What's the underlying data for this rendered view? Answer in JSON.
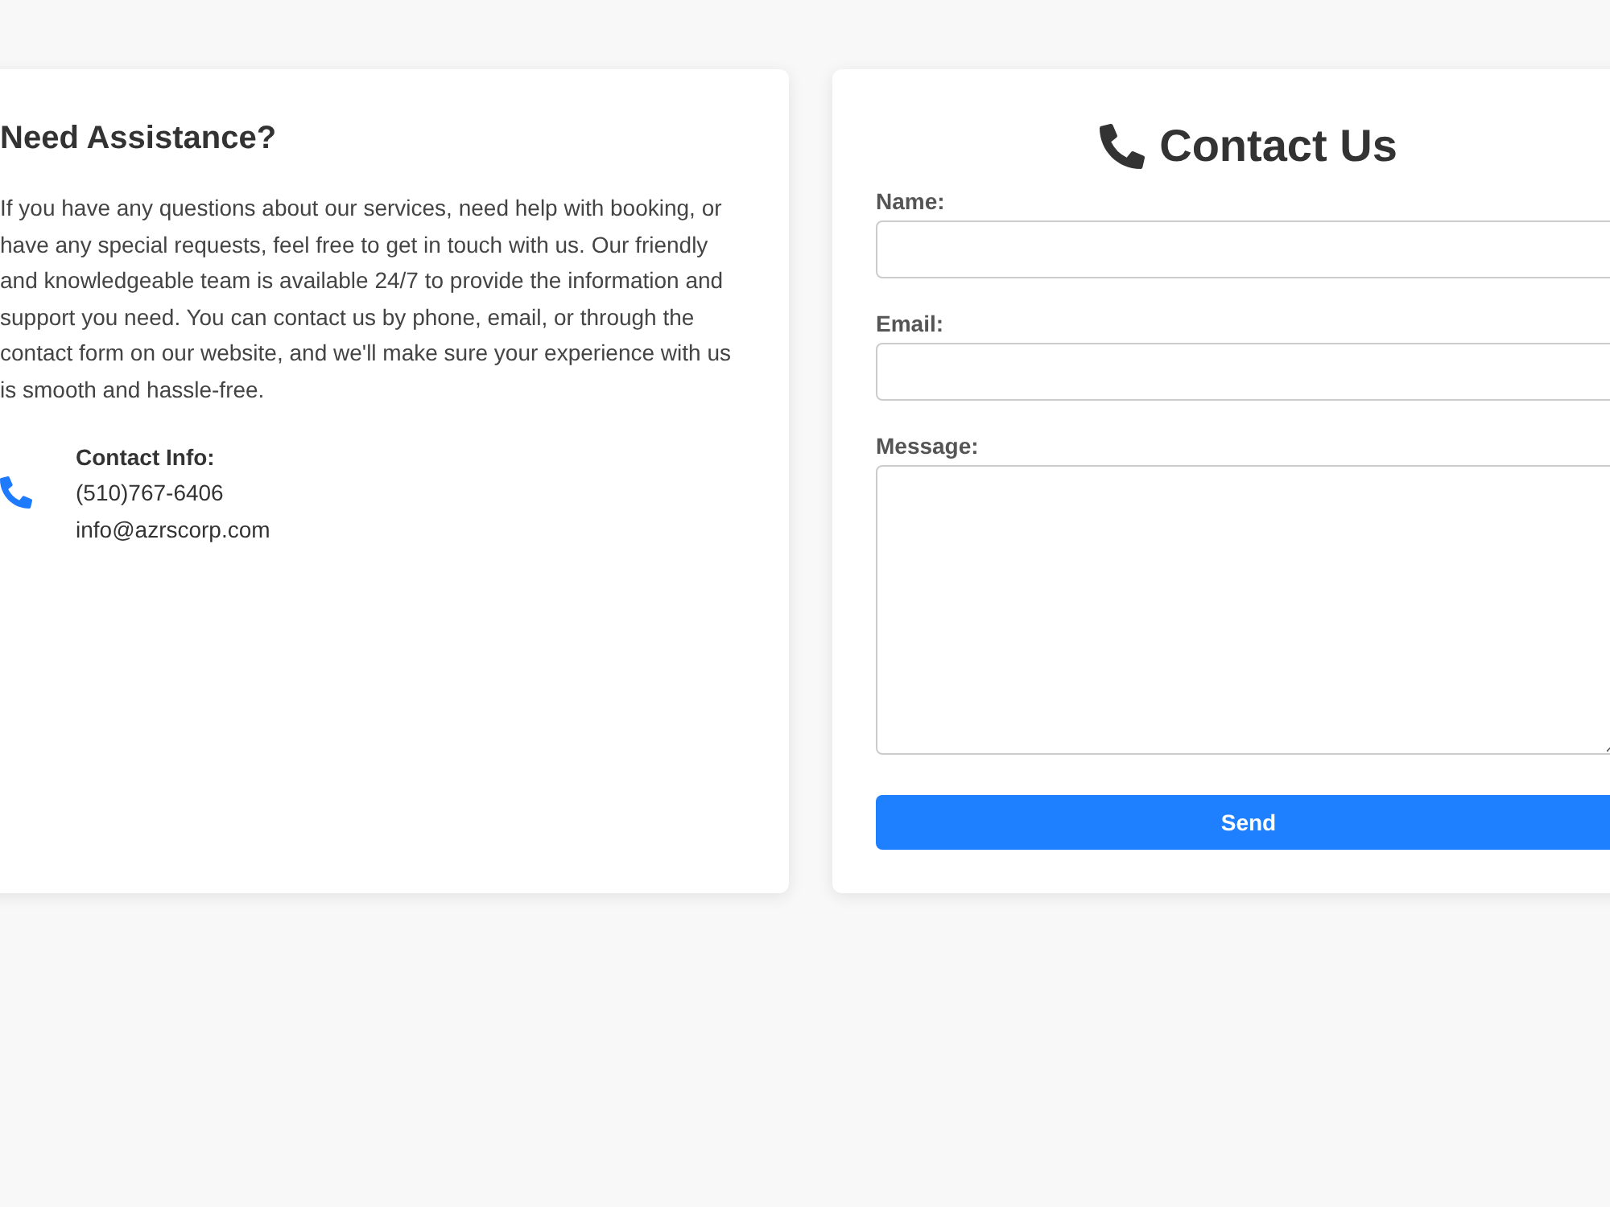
{
  "info_card": {
    "heading": "Need Assistance?",
    "paragraph": "If you have any questions about our services, need help with booking, or have any special requests, feel free to get in touch with us. Our friendly and knowledgeable team is available 24/7 to provide the information and support you need. You can contact us by phone, email, or through the contact form on our website, and we'll make sure your experience with us is smooth and hassle-free.",
    "contact": {
      "label": "Contact Info:",
      "phone": "(510)767-6406",
      "email": "info@azrscorp.com"
    }
  },
  "form": {
    "title": "Contact Us",
    "fields": [
      {
        "label": "Name:",
        "kind": "text"
      },
      {
        "label": "Email:",
        "kind": "text"
      },
      {
        "label": "Message:",
        "kind": "textarea"
      }
    ],
    "submit": "Send"
  }
}
